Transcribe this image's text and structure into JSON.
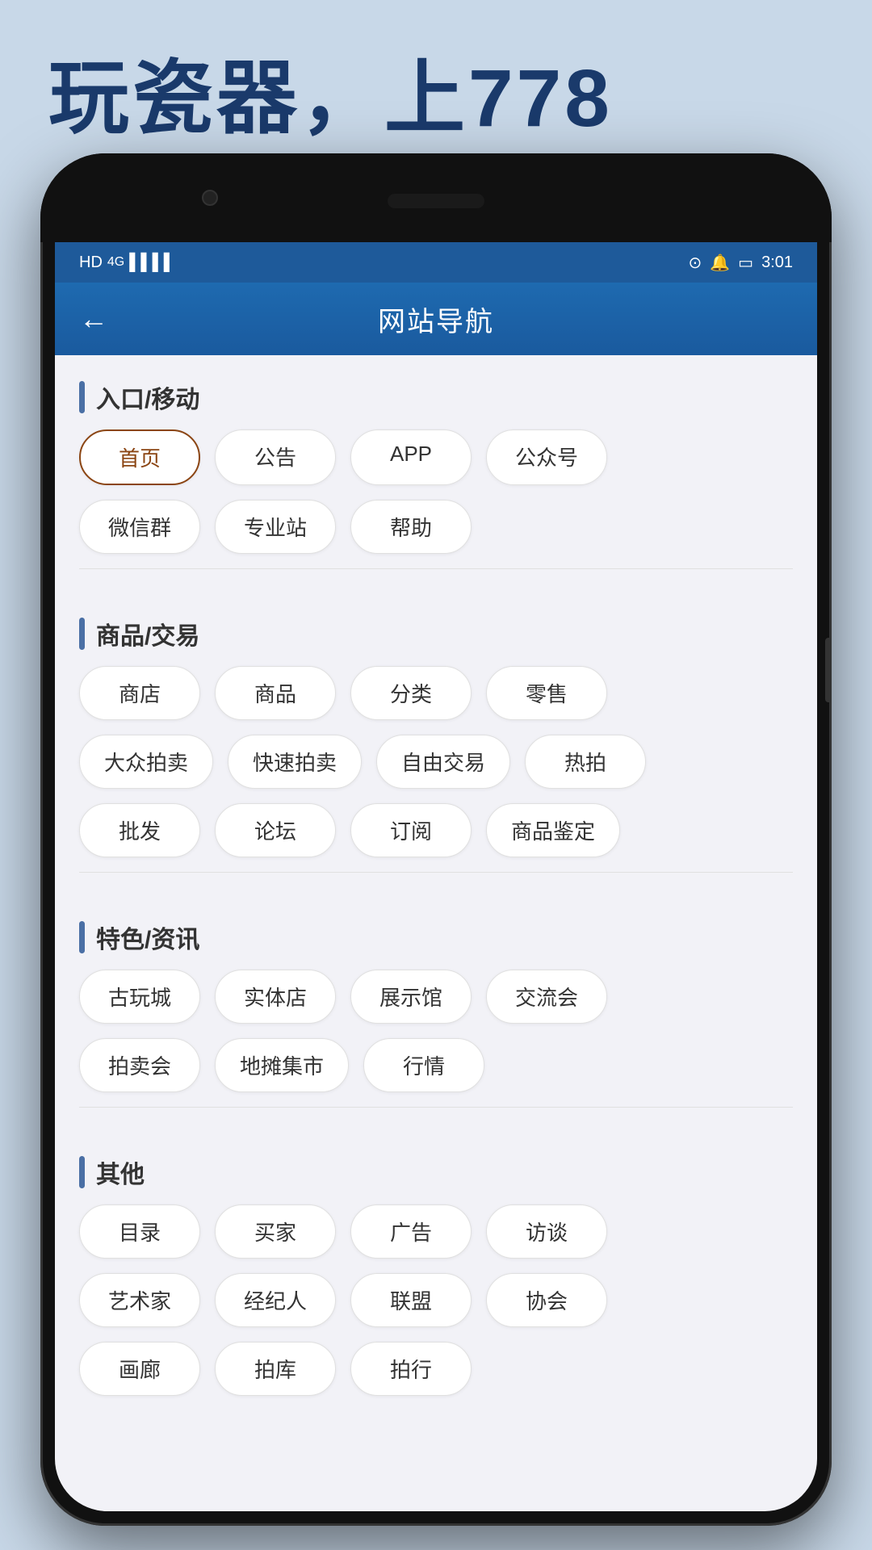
{
  "tagline": "玩瓷器，上778",
  "phone": {
    "status": {
      "left_icons": "HD 4G ▲▼ ||||",
      "right_icons": "⊙ 🔔",
      "time": "3:01"
    },
    "header": {
      "title": "网站导航",
      "back_label": "←"
    },
    "sections": [
      {
        "id": "entrance",
        "title": "入口/移动",
        "tags": [
          {
            "label": "首页",
            "active": true
          },
          {
            "label": "公告",
            "active": false
          },
          {
            "label": "APP",
            "active": false
          },
          {
            "label": "公众号",
            "active": false
          },
          {
            "label": "微信群",
            "active": false
          },
          {
            "label": "专业站",
            "active": false
          },
          {
            "label": "帮助",
            "active": false
          }
        ]
      },
      {
        "id": "goods",
        "title": "商品/交易",
        "tags": [
          {
            "label": "商店",
            "active": false
          },
          {
            "label": "商品",
            "active": false
          },
          {
            "label": "分类",
            "active": false
          },
          {
            "label": "零售",
            "active": false
          },
          {
            "label": "大众拍卖",
            "active": false
          },
          {
            "label": "快速拍卖",
            "active": false
          },
          {
            "label": "自由交易",
            "active": false
          },
          {
            "label": "热拍",
            "active": false
          },
          {
            "label": "批发",
            "active": false
          },
          {
            "label": "论坛",
            "active": false
          },
          {
            "label": "订阅",
            "active": false
          },
          {
            "label": "商品鉴定",
            "active": false
          }
        ]
      },
      {
        "id": "featured",
        "title": "特色/资讯",
        "tags": [
          {
            "label": "古玩城",
            "active": false
          },
          {
            "label": "实体店",
            "active": false
          },
          {
            "label": "展示馆",
            "active": false
          },
          {
            "label": "交流会",
            "active": false
          },
          {
            "label": "拍卖会",
            "active": false
          },
          {
            "label": "地摊集市",
            "active": false
          },
          {
            "label": "行情",
            "active": false
          }
        ]
      },
      {
        "id": "other",
        "title": "其他",
        "tags": [
          {
            "label": "目录",
            "active": false
          },
          {
            "label": "买家",
            "active": false
          },
          {
            "label": "广告",
            "active": false
          },
          {
            "label": "访谈",
            "active": false
          },
          {
            "label": "艺术家",
            "active": false
          },
          {
            "label": "经纪人",
            "active": false
          },
          {
            "label": "联盟",
            "active": false
          },
          {
            "label": "协会",
            "active": false
          },
          {
            "label": "画廊",
            "active": false
          },
          {
            "label": "拍库",
            "active": false
          },
          {
            "label": "拍行",
            "active": false
          }
        ]
      }
    ]
  }
}
